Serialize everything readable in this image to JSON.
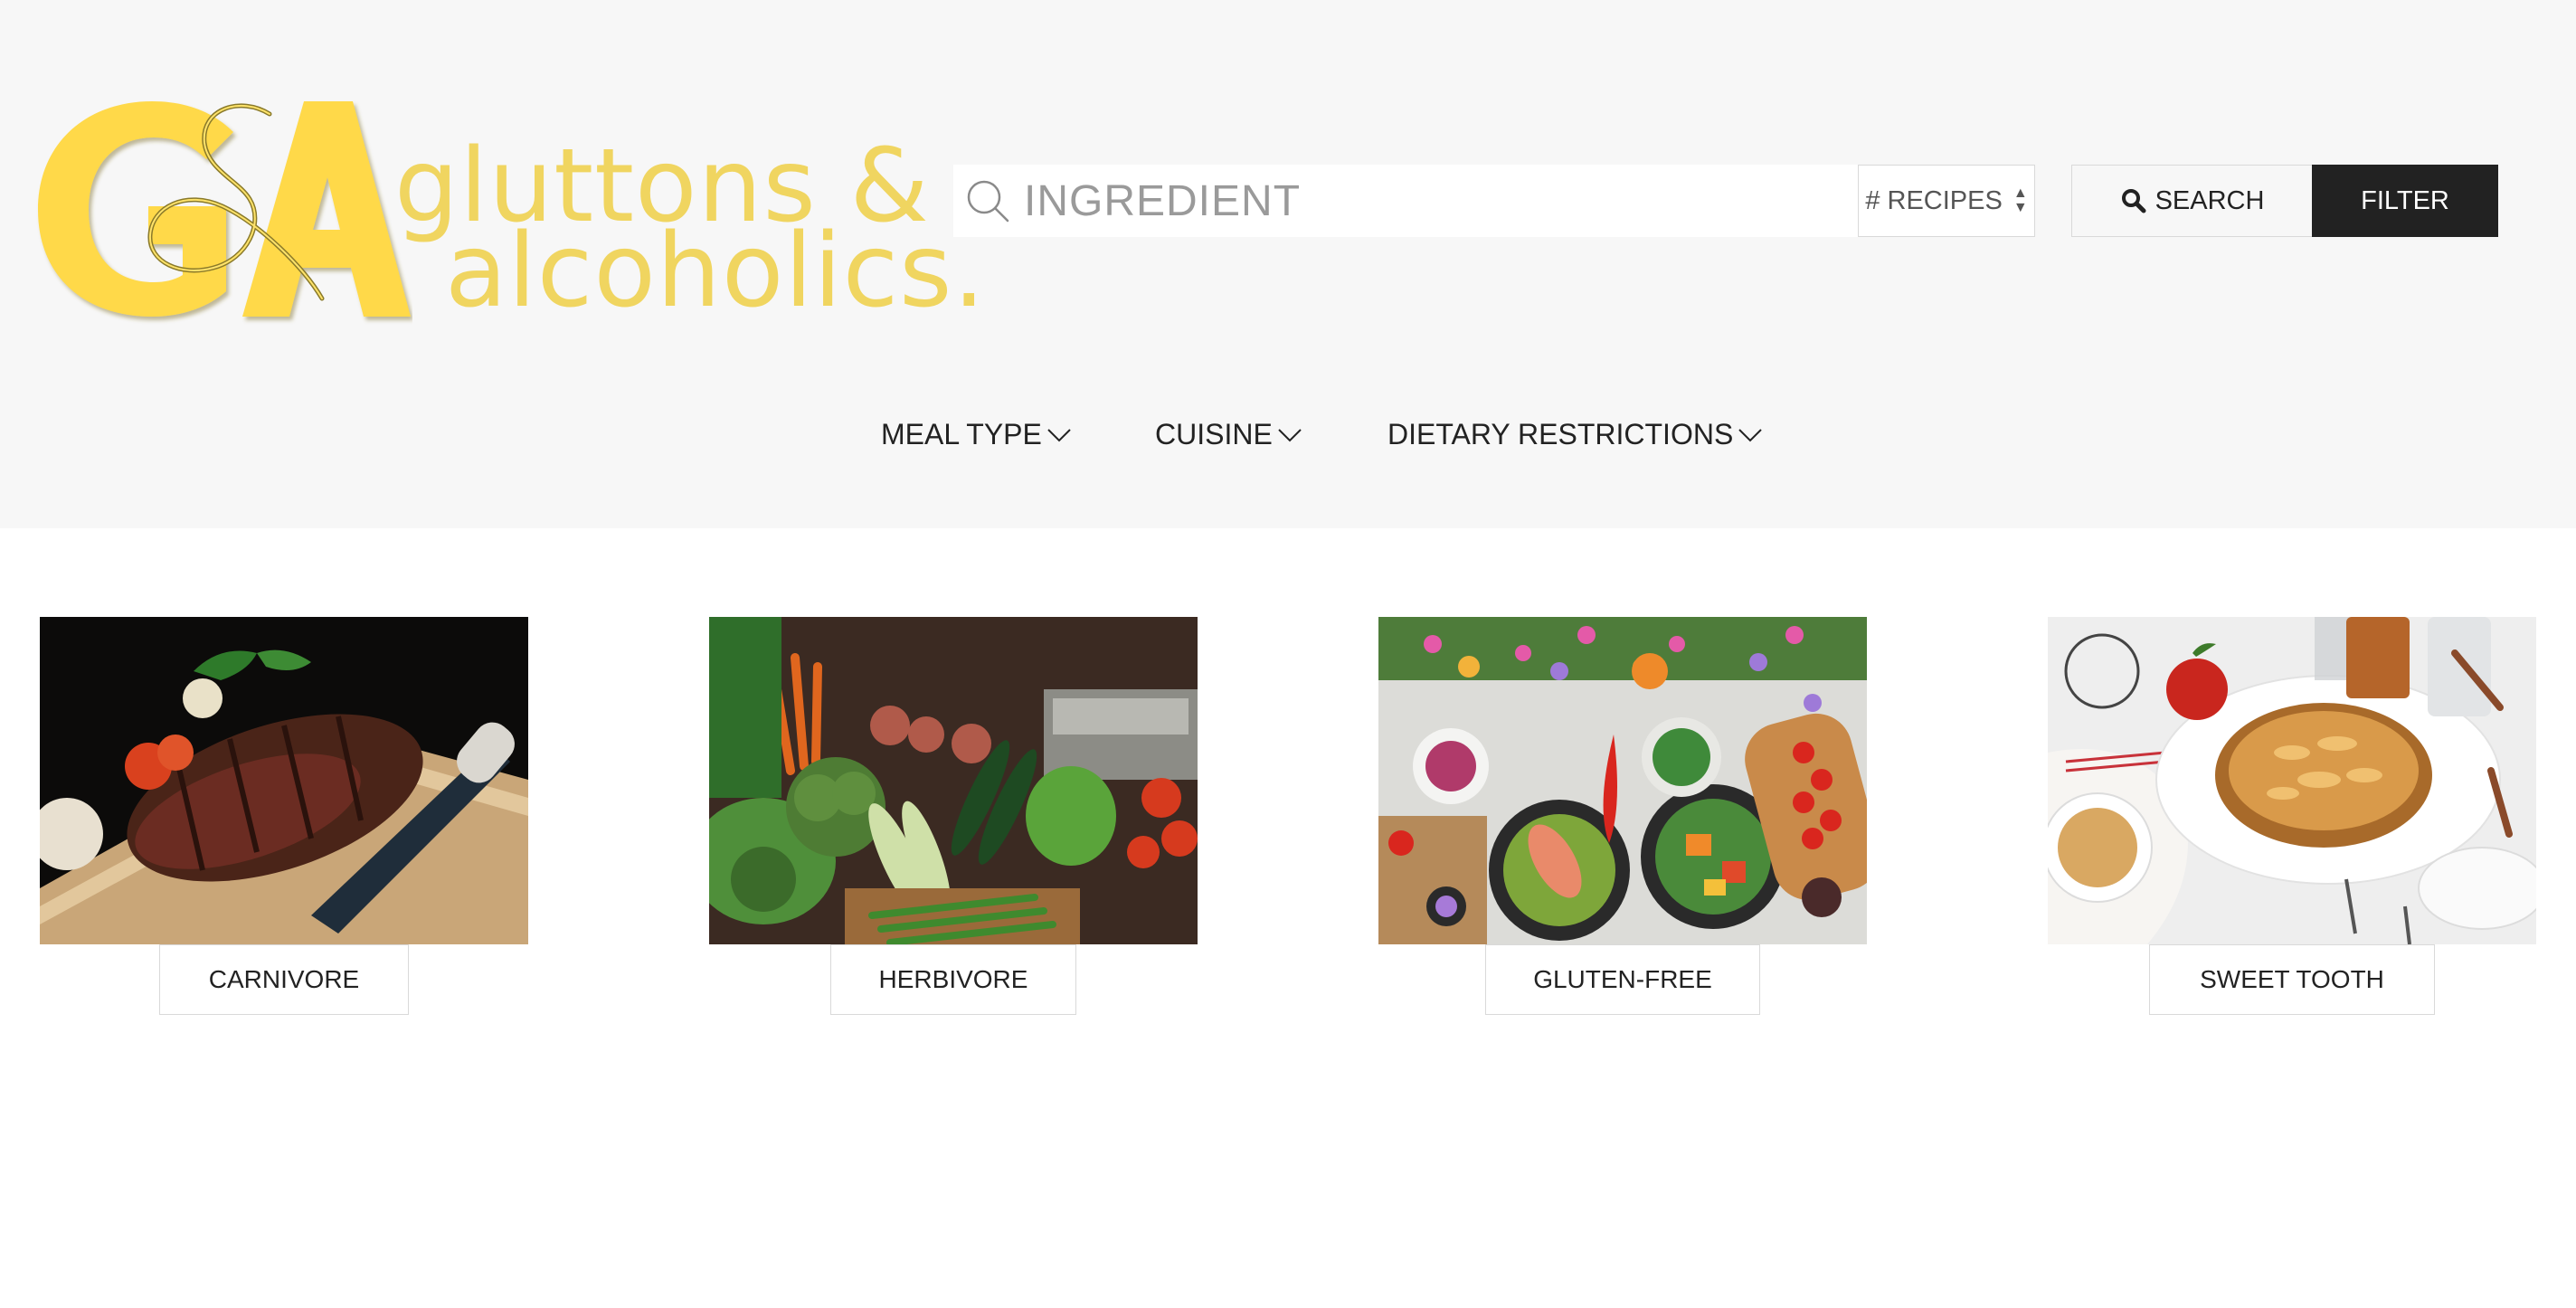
{
  "brand": {
    "monogram": "G&A",
    "name_line1": "gluttons &",
    "name_line2": "alcoholics.",
    "accent_color": "#f5d74a"
  },
  "search": {
    "placeholder": "INGREDIENT",
    "value": "",
    "recipes_select": "# RECIPES",
    "search_label": "SEARCH",
    "filter_label": "FILTER"
  },
  "nav": {
    "items": [
      {
        "label": "MEAL TYPE"
      },
      {
        "label": "CUISINE"
      },
      {
        "label": "DIETARY RESTRICTIONS"
      }
    ]
  },
  "categories": [
    {
      "label": "CARNIVORE",
      "image": "steak-photo"
    },
    {
      "label": "HERBIVORE",
      "image": "vegetables-photo"
    },
    {
      "label": "GLUTEN-FREE",
      "image": "salad-table-photo"
    },
    {
      "label": "SWEET TOOTH",
      "image": "apple-pie-photo"
    }
  ]
}
